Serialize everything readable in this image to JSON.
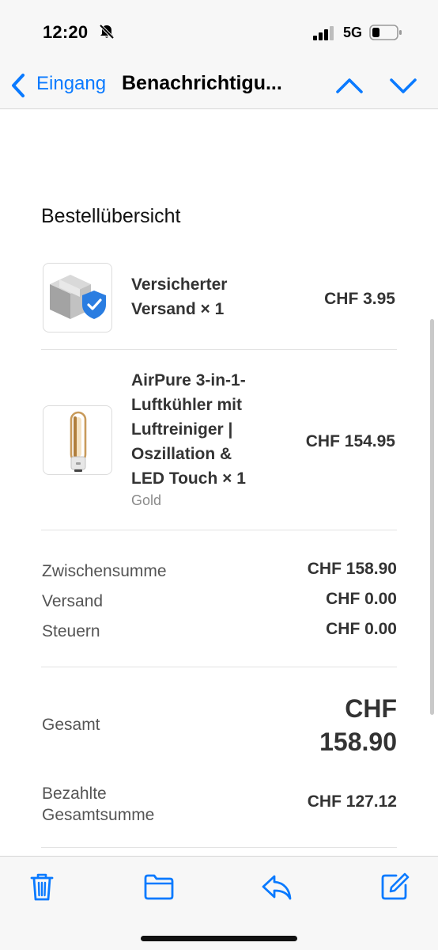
{
  "status_bar": {
    "time": "12:20",
    "network": "5G",
    "icons": [
      "bell-slash-icon",
      "signal-icon",
      "battery-icon"
    ]
  },
  "nav": {
    "back_label": "Eingang",
    "title": "Benachrichtigu...",
    "accent_color": "#0a7aff",
    "icons": [
      "chevron-left-icon",
      "chevron-up-icon",
      "chevron-down-icon"
    ]
  },
  "order": {
    "title": "Bestellübersicht",
    "items": [
      {
        "name_lines": [
          "Versicherter",
          "Versand × 1"
        ],
        "variant": "",
        "price": "CHF 3.95",
        "icon": "insured-package-icon"
      },
      {
        "name_lines": [
          "AirPure 3-in-1-",
          "Luftkühler mit",
          "Luftreiniger |",
          "Oszillation &",
          "LED Touch × 1"
        ],
        "variant": "Gold",
        "price": "CHF 154.95",
        "icon": "air-purifier-product-image"
      }
    ],
    "summary": [
      {
        "label": "Zwischensumme",
        "value": "CHF 158.90"
      },
      {
        "label": "Versand",
        "value": "CHF 0.00"
      },
      {
        "label": "Steuern",
        "value": "CHF 0.00"
      }
    ],
    "total": {
      "label": "Gesamt",
      "value_line1": "CHF",
      "value_line2": "158.90"
    },
    "paid": {
      "label_line1": "Bezahlte",
      "label_line2": "Gesamtsumme",
      "value": "CHF 127.12"
    }
  },
  "toolbar": {
    "icons": [
      "trash-icon",
      "folder-icon",
      "reply-icon",
      "compose-icon"
    ]
  }
}
